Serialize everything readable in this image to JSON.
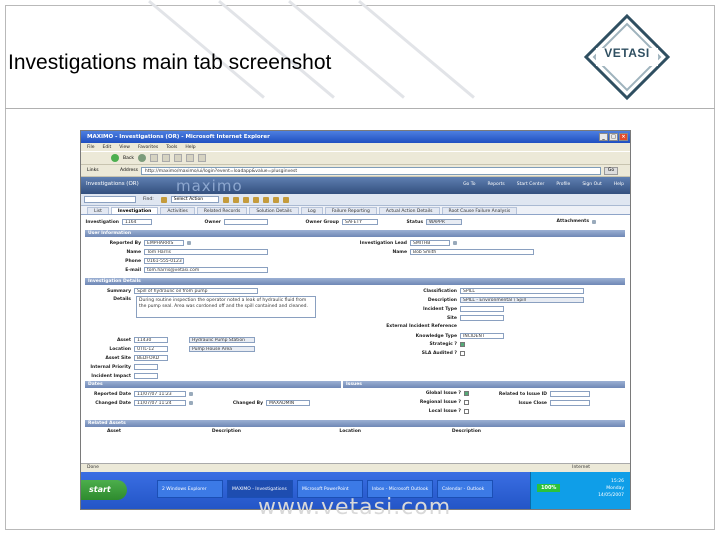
{
  "slide": {
    "title": "Investigations main tab screenshot",
    "logo_text": "VETASI",
    "watermark": "www.vetasi.com"
  },
  "browser": {
    "window_title": "MAXIMO - Investigations (OR) - Microsoft Internet Explorer",
    "menus": [
      "File",
      "Edit",
      "View",
      "Favorites",
      "Tools",
      "Help"
    ],
    "address_label": "Address",
    "address_value": "http://maximo/maximo/ui/login?event=loadapp&value=plusginvest",
    "go_label": "Go",
    "links_label": "Links",
    "back_label": "Back"
  },
  "app": {
    "header_title": "Investigations (OR)",
    "brand": "maximo",
    "nav_links": [
      "Go To",
      "Reports",
      "Start Center",
      "Profile",
      "Sign Out",
      "Help"
    ],
    "find_label": "Find:",
    "select_action": "Select Action",
    "tabs": [
      "List",
      "Investigation",
      "Activities",
      "Related Records",
      "Solution Details",
      "Log",
      "Failure Reporting",
      "Actual Action Details",
      "Root Cause Failure Analysis"
    ],
    "active_tab_index": 1,
    "top_fields": {
      "investigation_label": "Investigation",
      "investigation_value": "1164",
      "owner_label": "Owner",
      "owner_group_label": "Owner Group",
      "owner_group_value": "SAFETY",
      "status_label": "Status",
      "status_value": "WAPPR",
      "attachments_label": "Attachments"
    },
    "user_info": {
      "section": "User Information",
      "reported_by_label": "Reported By",
      "reported_by": "EMPHARRIS",
      "name_label": "Name",
      "name": "Tom Harris",
      "phone_label": "Phone",
      "phone": "0161-555-0123",
      "email_label": "E-mail",
      "email": "tom.harris@vetasi.com",
      "lead_label": "Investigation Lead",
      "lead": "SMITHB",
      "lead_name_label": "Name",
      "lead_name": "Bob Smith"
    },
    "details": {
      "section": "Investigation Details",
      "summary_label": "Summary",
      "summary": "Spill of hydraulic oil from pump",
      "details_label": "Details",
      "details_text": "During routine inspection the operator noted a leak of hydraulic fluid from the pump seal. Area was cordoned off and the spill contained and cleaned.",
      "classification_label": "Classification",
      "classification": "SPILL",
      "description_label": "Description",
      "description": "SPILL - Environmental \\ Spill",
      "incident_type_label": "Incident Type",
      "site_label": "Site",
      "external_ref_label": "External Incident Reference",
      "asset_label": "Asset",
      "asset": "11430",
      "asset_desc": "Hydraulic Pump Station",
      "location_label": "Location",
      "location": "UTIL-12",
      "location_desc": "Pump House Area",
      "asset_site_label": "Asset Site",
      "asset_site": "BEDFORD",
      "knowledge_label": "Knowledge Type",
      "knowledge": "INCIDENT",
      "strategic_label": "Strategic ?",
      "sla_label": "SLA Audited ?",
      "priority_label": "Internal Priority",
      "impact_label": "Incident Impact"
    },
    "dates": {
      "section": "Dates",
      "issues_section": "Issues",
      "reported_label": "Reported Date",
      "reported": "11/07/07 11:23",
      "changed_label": "Changed Date",
      "changed": "11/07/07 11:24",
      "changed_by_label": "Changed By",
      "changed_by": "MAXADMIN",
      "global_label": "Global Issue ?",
      "regional_label": "Regional Issue ?",
      "local_label": "Local Issue ?",
      "related_label": "Related to Issue ID",
      "close_label": "Issue Close"
    },
    "related": {
      "section": "Related Assets",
      "col_asset": "Asset",
      "col_desc": "Description",
      "col_location": "Location",
      "col_desc2": "Description"
    }
  },
  "statusbar": {
    "text": "Done",
    "zone": "Internet"
  },
  "taskbar": {
    "start": "start",
    "items": [
      "2 Windows Explorer",
      "MAXIMO - Investigations",
      "Microsoft PowerPoint",
      "Inbox - Microsoft Outlook",
      "Calendar - Outlook"
    ],
    "battery": "100%",
    "time": "15:26",
    "day": "Monday",
    "date": "14/05/2007"
  }
}
